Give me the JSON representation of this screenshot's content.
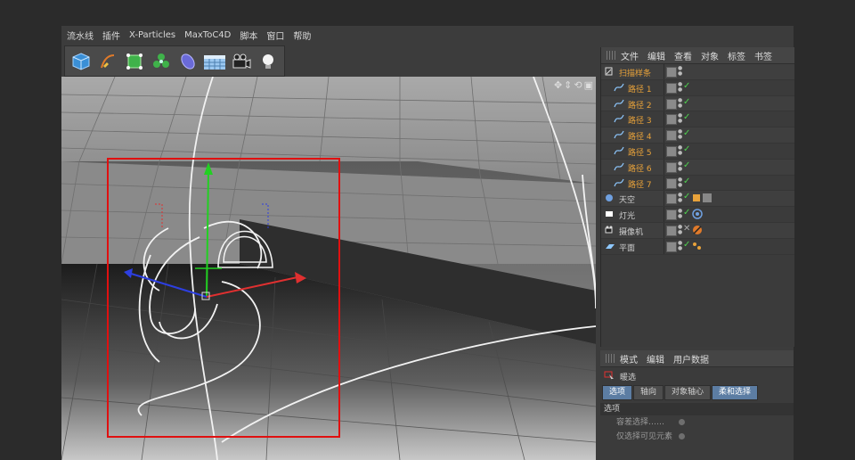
{
  "menubar": {
    "items": [
      "流水线",
      "插件",
      "X-Particles",
      "MaxToC4D",
      "脚本",
      "窗口",
      "帮助"
    ]
  },
  "toolbar": {
    "buttons": [
      "cube-icon",
      "pen-icon",
      "subdivision-icon",
      "cloner-icon",
      "deformer-icon",
      "floor-icon",
      "camera-icon",
      "light-icon"
    ]
  },
  "viewport": {
    "nav_icons": [
      "move-icon",
      "zoom-icon",
      "rotate-icon",
      "maximize-icon"
    ]
  },
  "object_manager": {
    "menu": [
      "文件",
      "编辑",
      "查看",
      "对象",
      "标签",
      "书签"
    ],
    "rows": [
      {
        "name": "扫描样条",
        "color": "orange",
        "indent": 0,
        "icon": "sweep-icon"
      },
      {
        "name": "路径 1",
        "color": "orange",
        "indent": 1,
        "icon": "spline-icon"
      },
      {
        "name": "路径 2",
        "color": "orange",
        "indent": 1,
        "icon": "spline-icon"
      },
      {
        "name": "路径 3",
        "color": "orange",
        "indent": 1,
        "icon": "spline-icon"
      },
      {
        "name": "路径 4",
        "color": "orange",
        "indent": 1,
        "icon": "spline-icon"
      },
      {
        "name": "路径 5",
        "color": "orange",
        "indent": 1,
        "icon": "spline-icon"
      },
      {
        "name": "路径 6",
        "color": "orange",
        "indent": 1,
        "icon": "spline-icon"
      },
      {
        "name": "路径 7",
        "color": "orange",
        "indent": 1,
        "icon": "spline-icon"
      },
      {
        "name": "天空",
        "color": "white",
        "indent": 0,
        "icon": "sky-icon"
      },
      {
        "name": "灯光",
        "color": "white",
        "indent": 0,
        "icon": "light-object-icon"
      },
      {
        "name": "摄像机",
        "color": "white",
        "indent": 0,
        "icon": "camera-object-icon"
      },
      {
        "name": "平面",
        "color": "white",
        "indent": 0,
        "icon": "plane-icon"
      }
    ]
  },
  "attribute_manager": {
    "menu": [
      "模式",
      "编辑",
      "用户数据"
    ],
    "title": "暖选",
    "tabs": [
      "选项",
      "轴向",
      "对象轴心",
      "柔和选择"
    ],
    "active_tab": "柔和选择",
    "section": "选项",
    "fields": [
      "容差选择……",
      "仅选择可见元素"
    ]
  },
  "colors": {
    "accent": "#5c7da3",
    "orange": "#e8a23a",
    "check": "#4fd04f",
    "highlight_box": "#e01010"
  }
}
